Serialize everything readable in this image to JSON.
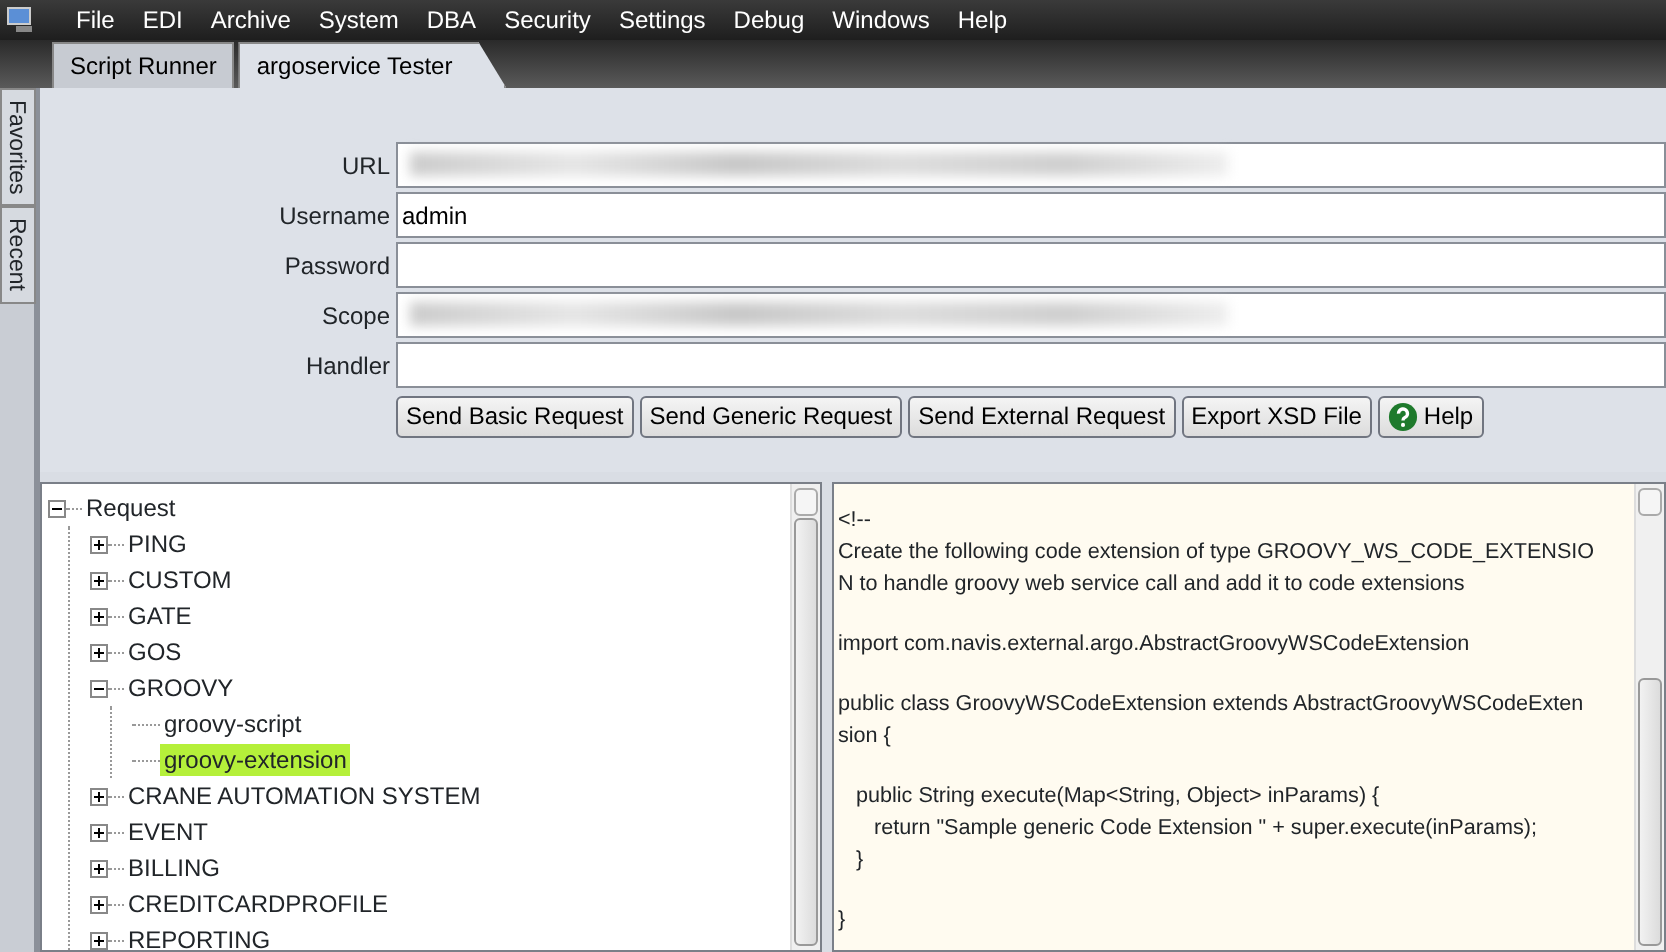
{
  "menu_bar": {
    "items": [
      "File",
      "EDI",
      "Archive",
      "System",
      "DBA",
      "Security",
      "Settings",
      "Debug",
      "Windows",
      "Help"
    ]
  },
  "side_tabs": [
    {
      "label": "Favorites",
      "selected": false
    },
    {
      "label": "Recent",
      "selected": false
    }
  ],
  "tabs": [
    {
      "label": "Script Runner",
      "selected": false
    },
    {
      "label": "argoservice Tester",
      "selected": true
    }
  ],
  "form": {
    "fields": [
      {
        "label": "URL",
        "kind": "redacted"
      },
      {
        "label": "Username",
        "kind": "text",
        "value": "admin"
      },
      {
        "label": "Password",
        "kind": "text"
      },
      {
        "label": "Scope",
        "kind": "redacted"
      },
      {
        "label": "Handler",
        "kind": "text"
      }
    ],
    "buttons": [
      {
        "label": "Send Basic Request",
        "kind": "plain"
      },
      {
        "label": "Send Generic Request",
        "kind": "plain"
      },
      {
        "label": "Send External Request",
        "kind": "plain"
      },
      {
        "label": "Export XSD File",
        "kind": "plain"
      },
      {
        "label": "Help",
        "kind": "help"
      }
    ]
  },
  "tree": [
    {
      "label": "Request",
      "expanded": true,
      "selected": false,
      "children": [
        {
          "label": "PING",
          "expanded": false,
          "selected": false
        },
        {
          "label": "CUSTOM",
          "expanded": false,
          "selected": false
        },
        {
          "label": "GATE",
          "expanded": false,
          "selected": false
        },
        {
          "label": "GOS",
          "expanded": false,
          "selected": false
        },
        {
          "label": "GROOVY",
          "expanded": true,
          "selected": false,
          "children": [
            {
              "label": "groovy-script",
              "selected": false
            },
            {
              "label": "groovy-extension",
              "selected": true
            }
          ]
        },
        {
          "label": "CRANE AUTOMATION SYSTEM",
          "expanded": false,
          "selected": false
        },
        {
          "label": "EVENT",
          "expanded": false,
          "selected": false
        },
        {
          "label": "BILLING",
          "expanded": false,
          "selected": false
        },
        {
          "label": "CREDITCARDPROFILE",
          "expanded": false,
          "selected": false
        },
        {
          "label": "REPORTING",
          "expanded": false,
          "selected": false
        }
      ]
    }
  ],
  "code_view": {
    "blocks": [
      [
        "<!--",
        "Create the following code extension of type GROOVY_WS_CODE_EXTENSIO",
        "N to handle groovy web service call and add it to code extensions"
      ],
      [
        "import com.navis.external.argo.AbstractGroovyWSCodeExtension"
      ],
      [
        "public class GroovyWSCodeExtension extends AbstractGroovyWSCodeExten",
        "sion {"
      ],
      [
        "   public String execute(Map<String, Object> inParams) {",
        "      return \"Sample generic Code Extension \" + super.execute(inParams);",
        "   }"
      ],
      [
        "}"
      ]
    ]
  }
}
